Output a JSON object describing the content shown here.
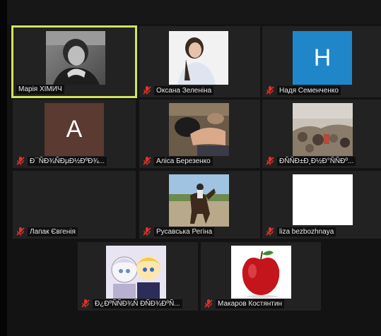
{
  "participants": [
    {
      "name": "Марія ХІМИЧ",
      "muted": false,
      "active": true
    },
    {
      "name": "Оксана Зеленіна",
      "muted": true
    },
    {
      "name": "Надя Семенченко",
      "muted": true,
      "initial": "Н",
      "avatar_color": "#1f86c9"
    },
    {
      "name": "Ð¯ÑÐ¾ÑÐµÐ½ÐºÐ¾...",
      "muted": true,
      "initial": "А",
      "avatar_color": "#5a3a31"
    },
    {
      "name": "Аліса Березенко",
      "muted": true
    },
    {
      "name": "ÐÑÑÐ±Ð¸Ð½Ð°ÑÑÐº...",
      "muted": true
    },
    {
      "name": "Лапак Євгенія",
      "muted": true
    },
    {
      "name": "Русавська Регіна",
      "muted": true
    },
    {
      "name": "liza bezbozhnaya",
      "muted": true
    },
    {
      "name": "Ð¿ÐºÑÑÐ¾Ñ ÐÑÐ¾ÐºÑ...",
      "muted": true
    },
    {
      "name": "Макаров Костянтин",
      "muted": true
    }
  ],
  "colors": {
    "active_border": "#d2e35f",
    "mic_muted": "#e0322b",
    "tile_bg": "#222222"
  }
}
